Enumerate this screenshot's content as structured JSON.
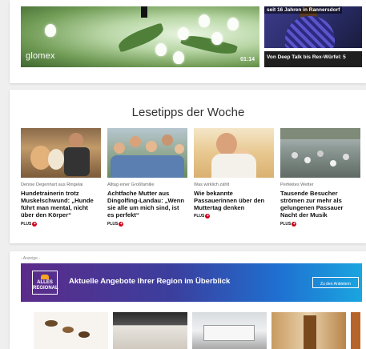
{
  "video": {
    "brand": "glomex",
    "duration": "01:14",
    "side_items": [
      {
        "caption": "seit 16 Jahren in Rannersdorf"
      },
      {
        "caption": "Von Deep Talk bis Rex-Würfel: 5"
      }
    ]
  },
  "lesetipps": {
    "title": "Lesetipps der Woche",
    "articles": [
      {
        "kicker": "Denise Degenhart aus Ringelai",
        "headline": "Hundetrainerin trotz Muskelschwund: „Hunde führt man mental, nicht über den Körper“",
        "badge": "PLUS"
      },
      {
        "kicker": "Alltag einer Großfamilie",
        "headline": "Achtfache Mutter aus Dingolfing-Landau: „Wenn sie alle um mich sind, ist es perfekt“",
        "badge": "PLUS"
      },
      {
        "kicker": "Was wirklich zählt",
        "headline": "Wie bekannte Passauerinnen über den Muttertag denken",
        "badge": "PLUS"
      },
      {
        "kicker": "Perfektes Wetter",
        "headline": "Tausende Besucher strömen zur mehr als gelungenen Passauer Nacht der Musik",
        "badge": "PLUS"
      }
    ]
  },
  "ad": {
    "label": "- Anzeige -",
    "logo_text": "ALLES REGIONAL",
    "headline": "Aktuelle Angebote Ihrer Region im Überblick",
    "button": "Zu den Anbietern"
  },
  "colors": {
    "plus_badge": "#d0021b",
    "ad_gradient_start": "#5b2b8a",
    "ad_gradient_end": "#1aa5e0"
  }
}
